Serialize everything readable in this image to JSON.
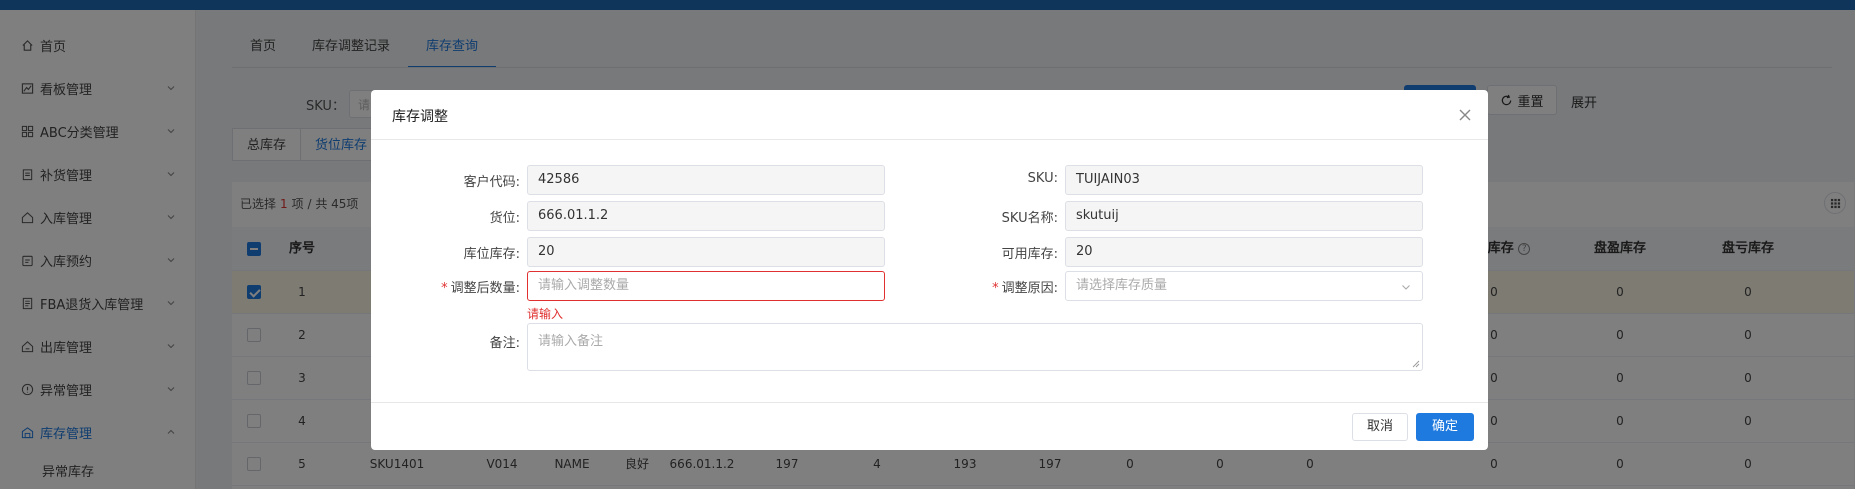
{
  "sidebar": {
    "items": [
      {
        "label": "首页",
        "icon": "home-icon",
        "expandable": false
      },
      {
        "label": "看板管理",
        "icon": "dashboard-icon",
        "expandable": true
      },
      {
        "label": "ABC分类管理",
        "icon": "grid-icon",
        "expandable": true
      },
      {
        "label": "补货管理",
        "icon": "clipboard-icon",
        "expandable": true
      },
      {
        "label": "入库管理",
        "icon": "inbound-icon",
        "expandable": true
      },
      {
        "label": "入库预约",
        "icon": "calendar-icon",
        "expandable": true
      },
      {
        "label": "FBA退货入库管理",
        "icon": "document-icon",
        "expandable": true
      },
      {
        "label": "出库管理",
        "icon": "outbound-icon",
        "expandable": true
      },
      {
        "label": "异常管理",
        "icon": "alert-icon",
        "expandable": true
      },
      {
        "label": "库存管理",
        "icon": "warehouse-icon",
        "expandable": true,
        "active": true
      }
    ],
    "subitem": "异常库存"
  },
  "tabs": [
    {
      "label": "首页"
    },
    {
      "label": "库存调整记录"
    },
    {
      "label": "库存查询",
      "active": true
    }
  ],
  "search": {
    "sku_label": "SKU：",
    "sku_placeholder": "请",
    "reset_label": "重置",
    "expand_label": "展开"
  },
  "subtabs": [
    {
      "label": "总库存"
    },
    {
      "label": "货位库存",
      "active": true
    }
  ],
  "table": {
    "selection": {
      "prefix": "已选择",
      "count": "1",
      "suffix": "项 / 共 45项"
    },
    "headers": {
      "index": "序号",
      "available": "库存",
      "gain": "盘盈库存",
      "loss": "盘亏库存"
    },
    "rows": [
      {
        "index": "1",
        "checked": true,
        "available": "0",
        "gain": "0",
        "loss": "0"
      },
      {
        "index": "2",
        "checked": false,
        "available": "0",
        "gain": "0",
        "loss": "0"
      },
      {
        "index": "3",
        "checked": false,
        "available": "0",
        "gain": "0",
        "loss": "0"
      },
      {
        "index": "4",
        "checked": false,
        "available": "0",
        "gain": "0",
        "loss": "0"
      }
    ],
    "row5": {
      "index": "5",
      "sku": "SKU1401",
      "code": "V014",
      "name": "NAME",
      "quality": "良好",
      "location": "666.01.1.2",
      "v1": "197",
      "v2": "4",
      "v3": "193",
      "v4": "197",
      "v5": "0",
      "v6": "0",
      "v7": "0",
      "v8": "0",
      "v9": "0",
      "v10": "0"
    }
  },
  "modal": {
    "title": "库存调整",
    "fields": {
      "customer_code": {
        "label": "客户代码:",
        "value": "42586"
      },
      "sku": {
        "label": "SKU:",
        "value": "TUIJAIN03"
      },
      "location": {
        "label": "货位:",
        "value": "666.01.1.2"
      },
      "sku_name": {
        "label": "SKU名称:",
        "value": "skutuij"
      },
      "location_stock": {
        "label": "库位库存:",
        "value": "20"
      },
      "available_stock": {
        "label": "可用库存:",
        "value": "20"
      },
      "adjusted_qty": {
        "label": "调整后数量:",
        "placeholder": "请输入调整数量",
        "error": "请输入"
      },
      "reason": {
        "label": "调整原因:",
        "placeholder": "请选择库存质量"
      },
      "remark": {
        "label": "备注:",
        "placeholder": "请输入备注"
      }
    },
    "cancel_label": "取消",
    "ok_label": "确定"
  },
  "colors": {
    "primary": "#1f7ae0",
    "error": "#e03030",
    "topbar": "#1f6db5"
  }
}
